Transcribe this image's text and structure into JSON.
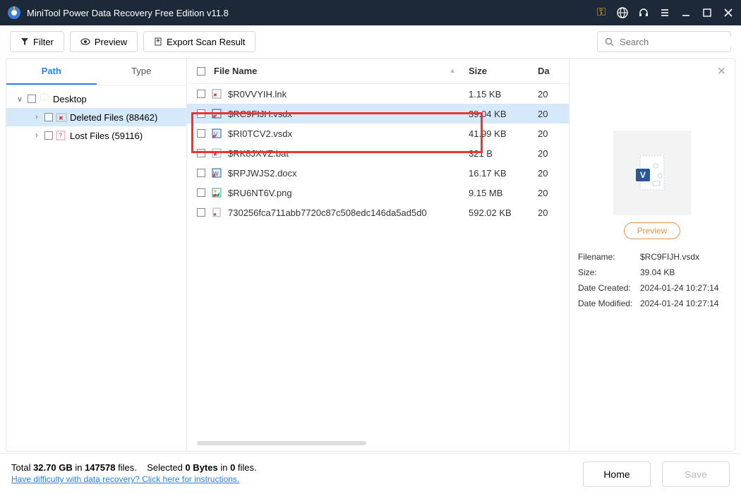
{
  "title": "MiniTool Power Data Recovery Free Edition v11.8",
  "toolbar": {
    "filter": "Filter",
    "preview": "Preview",
    "export": "Export Scan Result"
  },
  "search": {
    "placeholder": "Search"
  },
  "tabs": {
    "path": "Path",
    "type": "Type"
  },
  "tree": {
    "root": "Desktop",
    "children": [
      {
        "label": "Deleted Files (88462)",
        "selected": true
      },
      {
        "label": "Lost Files (59116)",
        "selected": false
      }
    ]
  },
  "columns": {
    "name": "File Name",
    "size": "Size",
    "date": "Da"
  },
  "files": [
    {
      "name": "$R0VVYIH.lnk",
      "size": "1.15 KB",
      "date": "20",
      "icon": "link",
      "highlight": false
    },
    {
      "name": "$RC9FIJH.vsdx",
      "size": "39.04 KB",
      "date": "20",
      "icon": "vsdx",
      "highlight": true
    },
    {
      "name": "$RI0TCV2.vsdx",
      "size": "41.99 KB",
      "date": "20",
      "icon": "vsdx",
      "highlight": false
    },
    {
      "name": "$RK8JXVZ.bat",
      "size": "321 B",
      "date": "20",
      "icon": "bat",
      "highlight": false
    },
    {
      "name": "$RPJWJS2.docx",
      "size": "16.17 KB",
      "date": "20",
      "icon": "docx",
      "highlight": false
    },
    {
      "name": "$RU6NT6V.png",
      "size": "9.15 MB",
      "date": "20",
      "icon": "png",
      "highlight": false
    },
    {
      "name": "730256fca711abb7720c87c508edc146da5ad5d0",
      "size": "592.02 KB",
      "date": "20",
      "icon": "file",
      "highlight": false
    }
  ],
  "preview": {
    "button": "Preview",
    "meta": {
      "filename_k": "Filename:",
      "filename_v": "$RC9FIJH.vsdx",
      "size_k": "Size:",
      "size_v": "39.04 KB",
      "created_k": "Date Created:",
      "created_v": "2024-01-24 10:27:14",
      "modified_k": "Date Modified:",
      "modified_v": "2024-01-24 10:27:14"
    }
  },
  "footer": {
    "total_pre": "Total ",
    "total_size": "32.70 GB",
    "total_mid": " in ",
    "total_count": "147578",
    "total_suf": " files.",
    "sel_pre": "Selected ",
    "sel_size": "0 Bytes",
    "sel_mid": " in ",
    "sel_count": "0",
    "sel_suf": " files.",
    "help": "Have difficulty with data recovery? Click here for instructions.",
    "home": "Home",
    "save": "Save"
  }
}
